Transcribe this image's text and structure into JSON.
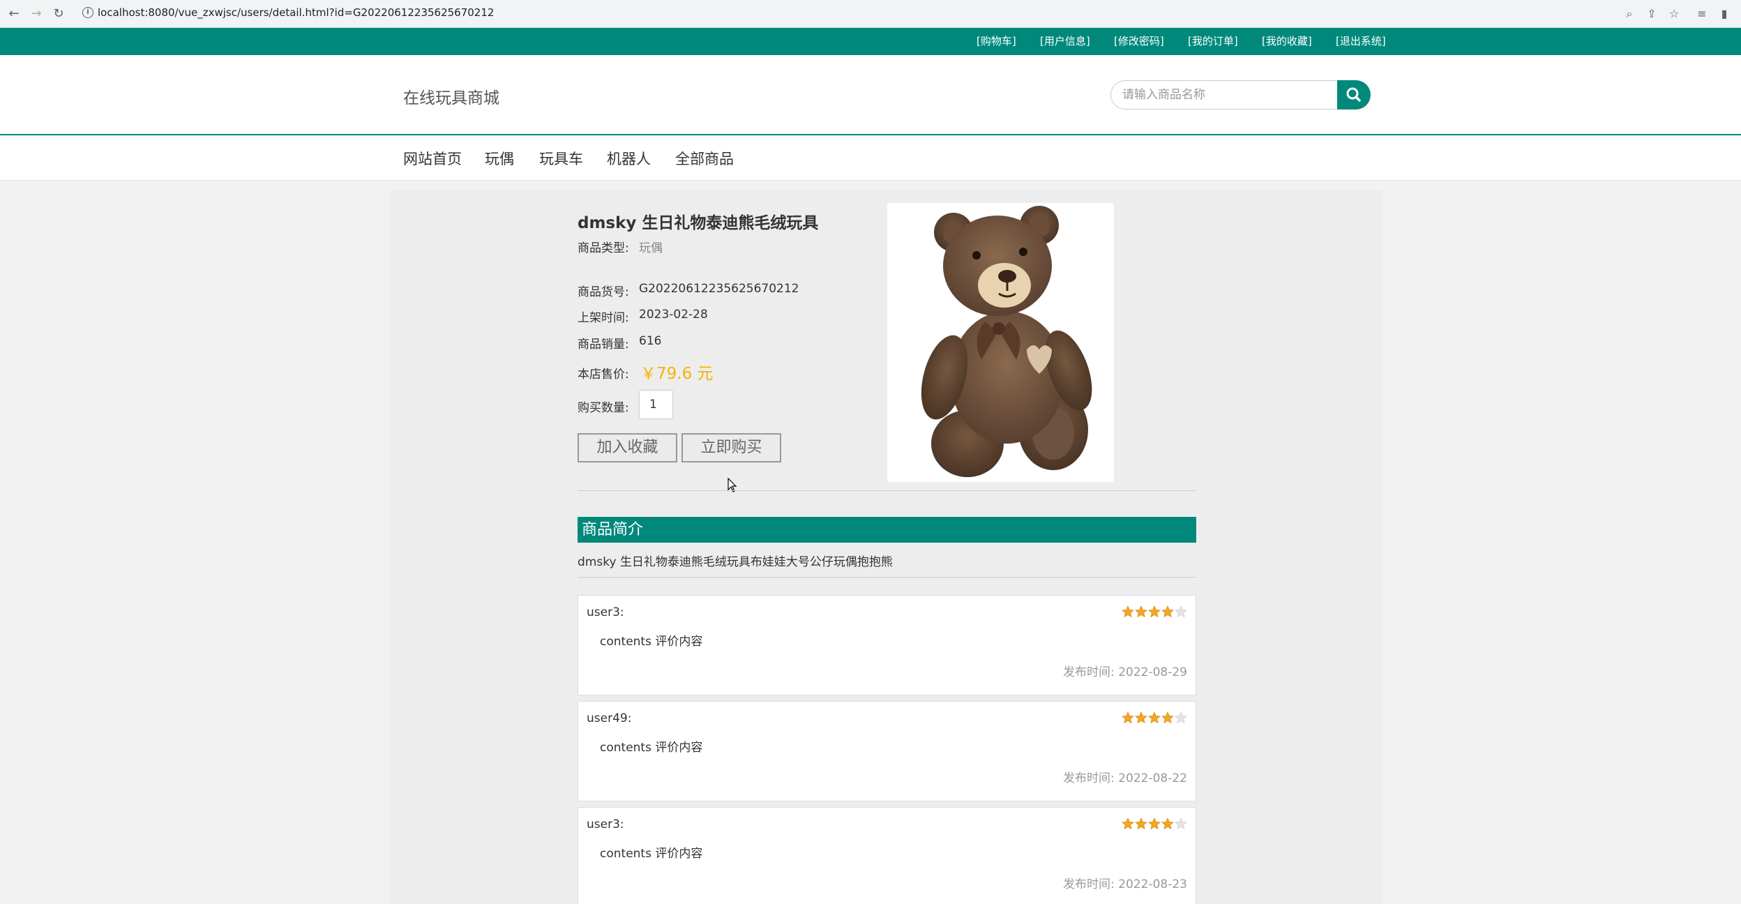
{
  "browser": {
    "url": "localhost:8080/vue_zxwjsc/users/detail.html?id=G20220612235625670212"
  },
  "top_links": [
    "[购物车]",
    "[用户信息]",
    "[修改密码]",
    "[我的订单]",
    "[我的收藏]",
    "[退出系统]"
  ],
  "header": {
    "site_title": "在线玩具商城",
    "search_placeholder": "请输入商品名称"
  },
  "nav": [
    "网站首页",
    "玩偶",
    "玩具车",
    "机器人",
    "全部商品"
  ],
  "product": {
    "name": "dmsky 生日礼物泰迪熊毛绒玩具",
    "type_label": "商品类型:",
    "type_value": "玩偶",
    "sku_label": "商品货号:",
    "sku_value": "G20220612235625670212",
    "date_label": "上架时间:",
    "date_value": "2023-02-28",
    "sales_label": "商品销量:",
    "sales_value": "616",
    "price_label": "本店售价:",
    "price_value": "￥79.6 元",
    "qty_label": "购买数量:",
    "qty_value": "1",
    "fav_button": "加入收藏",
    "buy_button": "立即购买"
  },
  "intro": {
    "title": "商品简介",
    "text": "dmsky 生日礼物泰迪熊毛绒玩具布娃娃大号公仔玩偶抱抱熊"
  },
  "reviews": [
    {
      "user": "user3:",
      "content": "contents 评价内容",
      "time_label": "发布时间:",
      "time": "2022-08-29",
      "rating": 4
    },
    {
      "user": "user49:",
      "content": "contents 评价内容",
      "time_label": "发布时间:",
      "time": "2022-08-22",
      "rating": 4
    },
    {
      "user": "user3:",
      "content": "contents 评价内容",
      "time_label": "发布时间:",
      "time": "2022-08-23",
      "rating": 4
    }
  ],
  "colors": {
    "accent": "#00897b",
    "price": "#f5b400",
    "star": "#f5a623"
  }
}
